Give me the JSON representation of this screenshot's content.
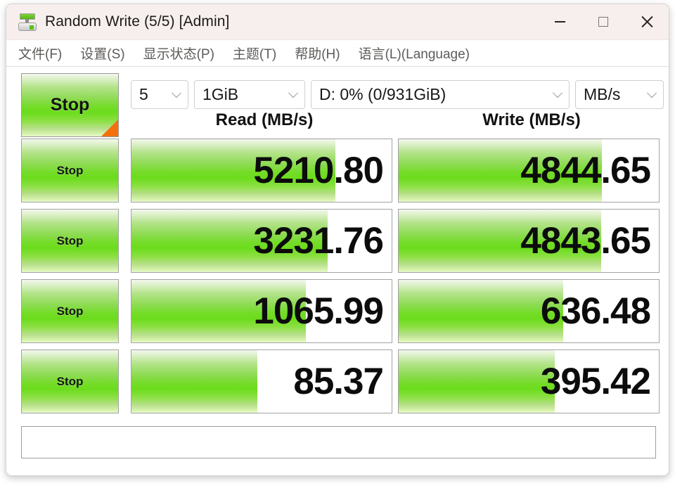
{
  "window": {
    "title": "Random Write (5/5) [Admin]",
    "icon": "disk-benchmark-icon",
    "controls": {
      "minimize": "minimize-icon",
      "maximize": "maximize-icon",
      "close": "close-icon"
    }
  },
  "menubar": {
    "items": [
      {
        "label": "文件(F)"
      },
      {
        "label": "设置(S)"
      },
      {
        "label": "显示状态(P)"
      },
      {
        "label": "主题(T)"
      },
      {
        "label": "帮助(H)"
      },
      {
        "label": "语言(L)(Language)"
      }
    ]
  },
  "toolbar": {
    "main_button_label": "Stop",
    "test_count": "5",
    "test_size": "1GiB",
    "drive": "D: 0% (0/931GiB)",
    "unit": "MB/s"
  },
  "columns": {
    "read_header": "Read (MB/s)",
    "write_header": "Write (MB/s)"
  },
  "rows": [
    {
      "button_label": "Stop",
      "read_value": "5210.80",
      "read_fill_pct": 78.5,
      "write_value": "4844.65",
      "write_fill_pct": 78.0
    },
    {
      "button_label": "Stop",
      "read_value": "3231.76",
      "read_fill_pct": 75.5,
      "write_value": "4843.65",
      "write_fill_pct": 77.8
    },
    {
      "button_label": "Stop",
      "read_value": "1065.99",
      "read_fill_pct": 67.0,
      "write_value": "636.48",
      "write_fill_pct": 63.2
    },
    {
      "button_label": "Stop",
      "read_value": "85.37",
      "read_fill_pct": 48.5,
      "write_value": "395.42",
      "write_fill_pct": 60.0
    }
  ],
  "statusbar": {
    "text": ""
  },
  "colors": {
    "accent_green": "#6cdc1c",
    "corner_orange": "#f4700d",
    "titlebar_bg": "#f7efee"
  }
}
